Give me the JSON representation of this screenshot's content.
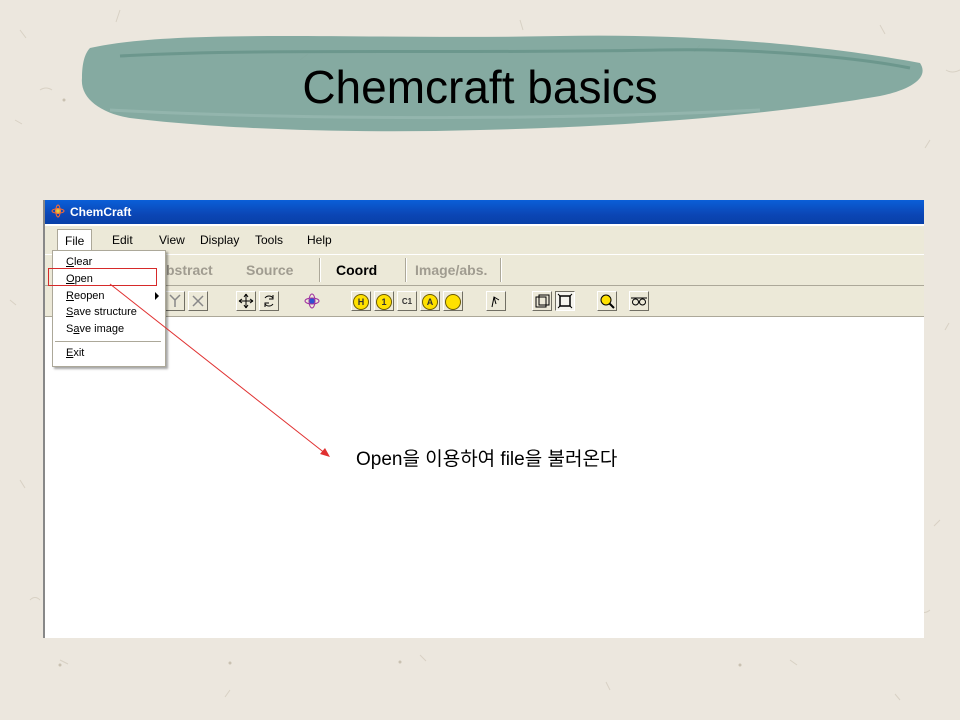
{
  "slide": {
    "title": "Chemcraft basics",
    "annotation": "Open을 이용하여 file을 불러온다"
  },
  "window": {
    "title": "ChemCraft",
    "icon": "chemcraft-atom-icon"
  },
  "menubar": {
    "items": [
      "File",
      "Edit",
      "View",
      "Display",
      "Tools",
      "Help"
    ],
    "open_menu": "File"
  },
  "tabs": {
    "items": [
      "Abstract",
      "Source",
      "Coord",
      "Image/abs."
    ],
    "visible_text": [
      "bstract",
      "Source",
      "Coord",
      "Image/abs."
    ],
    "active": "Coord"
  },
  "toolbar": {
    "buttons": [
      {
        "icon": "tree-icon",
        "label": ""
      },
      {
        "icon": "molecule-x-icon",
        "label": ""
      },
      {
        "icon": "move-arrows-icon",
        "label": ""
      },
      {
        "icon": "rotate-icon",
        "label": ""
      },
      {
        "icon": "atom-orbit-icon",
        "label": ""
      },
      {
        "icon": "hydrogen-label-icon",
        "label": "H"
      },
      {
        "icon": "number-label-icon",
        "label": "1"
      },
      {
        "icon": "c1-label-icon",
        "label": "C1"
      },
      {
        "icon": "atom-a-label-icon",
        "label": "A"
      },
      {
        "icon": "yellow-dot-icon",
        "label": ""
      },
      {
        "icon": "dihedral-icon",
        "label": ""
      },
      {
        "icon": "box-icon",
        "label": ""
      },
      {
        "icon": "box-pressed-icon",
        "label": ""
      },
      {
        "icon": "magnifier-icon",
        "label": ""
      },
      {
        "icon": "glasses-icon",
        "label": ""
      }
    ]
  },
  "file_menu": {
    "items": [
      {
        "label": "Clear",
        "underline": "C",
        "rest": "lear"
      },
      {
        "label": "Open",
        "underline": "O",
        "rest": "pen"
      },
      {
        "label": "Reopen",
        "underline": "R",
        "rest": "eopen",
        "submenu": true
      },
      {
        "label": "Save structure",
        "underline": "S",
        "rest": "ave structure"
      },
      {
        "label": "Save image",
        "underline": "S",
        "rest": "a",
        "rest2": "ve image",
        "underline_index": 1
      },
      {
        "label": "Exit",
        "underline": "E",
        "rest": "xit"
      }
    ],
    "highlighted": "Open"
  },
  "colors": {
    "titlebar": "#0b46b5",
    "highlight_box": "#d62a2a",
    "arrow": "#e03030",
    "brush": "#7aa39a",
    "chrome": "#ece9d8"
  }
}
